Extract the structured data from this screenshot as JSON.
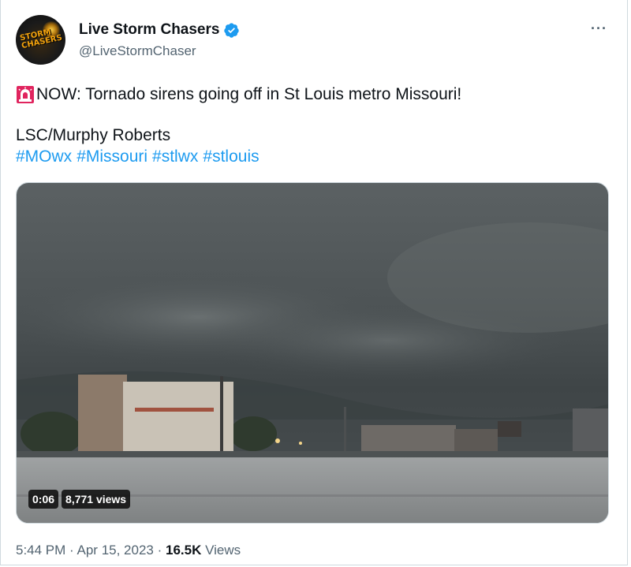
{
  "author": {
    "display_name": "Live Storm Chasers",
    "handle": "@LiveStormChaser",
    "avatar_logo_text": "STORM CHASERS",
    "verified": true
  },
  "more_menu_label": "···",
  "tweet": {
    "line1_text": "NOW: Tornado sirens going off in St Louis metro Missouri!",
    "line1_icon": "rotating-light-icon",
    "credit": "LSC/Murphy Roberts",
    "hashtags": [
      "#MOwx",
      "#Missouri",
      "#stlwx",
      "#stlouis"
    ]
  },
  "media": {
    "type": "video",
    "duration": "0:06",
    "views_badge": "8,771 views"
  },
  "meta": {
    "time": "5:44 PM",
    "separator": "·",
    "date": "Apr 15, 2023",
    "views_count": "16.5K",
    "views_label": "Views"
  },
  "colors": {
    "link": "#1d9bf0",
    "text": "#0f1419",
    "muted": "#536471",
    "border": "#cfd9de"
  }
}
